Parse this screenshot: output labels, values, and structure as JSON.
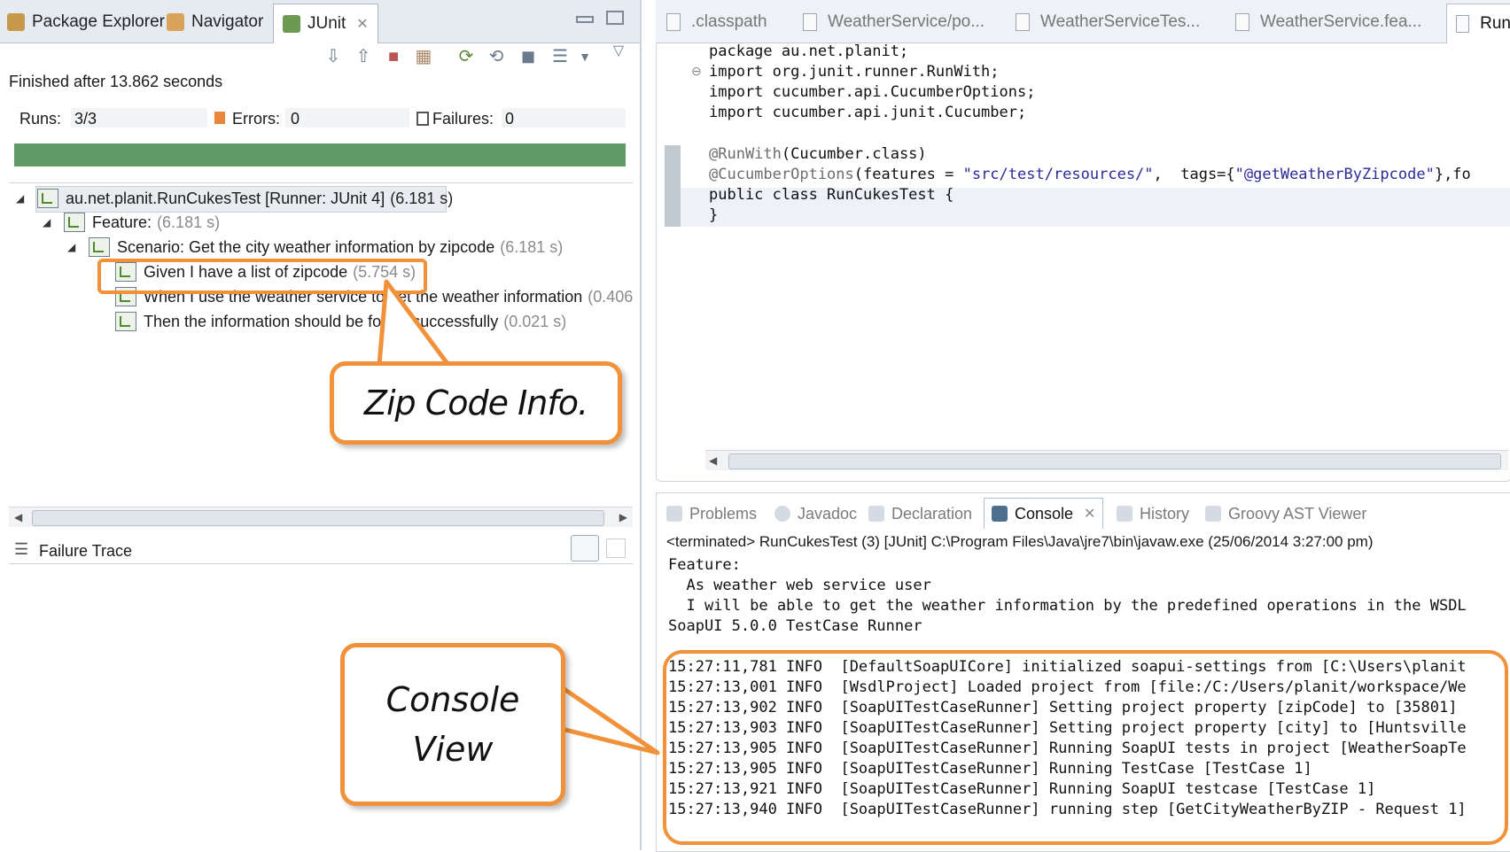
{
  "left_tabs": [
    {
      "label": "Package Explorer"
    },
    {
      "label": "Navigator"
    },
    {
      "label": "JUnit"
    }
  ],
  "junit": {
    "finished": "Finished after 13.862 seconds",
    "runs_label": "Runs:",
    "runs_value": "3/3",
    "errors_label": "Errors:",
    "errors_value": "0",
    "failures_label": "Failures:",
    "failures_value": "0",
    "progress_color": "#5e9b67"
  },
  "tree": [
    {
      "label": "au.net.planit.RunCukesTest [Runner: JUnit 4]",
      "time": "(6.181 s)"
    },
    {
      "label": "Feature:",
      "time": "(6.181 s)"
    },
    {
      "label": "Scenario: Get the city weather information by zipcode",
      "time": "(6.181 s)"
    },
    {
      "label": "Given I have a list of zipcode",
      "time": "(5.754 s)"
    },
    {
      "label": "When I use the weather service to get the weather information",
      "time": "(0.406"
    },
    {
      "label": "Then the information should be found successfully",
      "time": "(0.021 s)"
    }
  ],
  "failure_trace": {
    "label": "Failure Trace"
  },
  "editor_tabs": [
    {
      "label": ".classpath"
    },
    {
      "label": "WeatherService/po..."
    },
    {
      "label": "WeatherServiceTes..."
    },
    {
      "label": "WeatherService.fea..."
    },
    {
      "label": "Run"
    }
  ],
  "code": {
    "l1": "package au.net.planit;",
    "l2": "import org.junit.runner.RunWith;",
    "l3": "import cucumber.api.CucumberOptions;",
    "l4": "import cucumber.api.junit.Cucumber;",
    "l5_ann": "@RunWith",
    "l5_rest": "(Cucumber.class)",
    "l6_ann": "@CucumberOptions",
    "l6_a": "(features = ",
    "l6_str1": "\"src/test/resources/\"",
    "l6_b": ",  tags={",
    "l6_str2": "\"@getWeatherByZipcode\"",
    "l6_c": "},fo",
    "l7": "public class RunCukesTest {",
    "l8": "}"
  },
  "console_tabs": [
    {
      "label": "Problems"
    },
    {
      "label": "Javadoc"
    },
    {
      "label": "Declaration"
    },
    {
      "label": "Console"
    },
    {
      "label": "History"
    },
    {
      "label": "Groovy AST Viewer"
    }
  ],
  "console": {
    "status": "<terminated> RunCukesTest (3) [JUnit] C:\\Program Files\\Java\\jre7\\bin\\javaw.exe (25/06/2014 3:27:00 pm)",
    "lines": [
      "Feature:",
      "  As weather web service user",
      "  I will be able to get the weather information by the predefined operations in the WSDL",
      "SoapUI 5.0.0 TestCase Runner",
      "15:27:11,781 INFO  [DefaultSoapUICore] initialized soapui-settings from [C:\\Users\\planit",
      "15:27:13,001 INFO  [WsdlProject] Loaded project from [file:/C:/Users/planit/workspace/We",
      "15:27:13,902 INFO  [SoapUITestCaseRunner] Setting project property [zipCode] to [35801]",
      "15:27:13,903 INFO  [SoapUITestCaseRunner] Setting project property [city] to [Huntsville",
      "15:27:13,905 INFO  [SoapUITestCaseRunner] Running SoapUI tests in project [WeatherSoapTe",
      "15:27:13,905 INFO  [SoapUITestCaseRunner] Running TestCase [TestCase 1]",
      "15:27:13,921 INFO  [SoapUITestCaseRunner] Running SoapUI testcase [TestCase 1]",
      "15:27:13,940 INFO  [SoapUITestCaseRunner] running step [GetCityWeatherByZIP - Request 1]"
    ]
  },
  "callouts": {
    "zip": "Zip Code Info.",
    "console_1": "Console",
    "console_2": "View",
    "color": "#f1923b"
  }
}
